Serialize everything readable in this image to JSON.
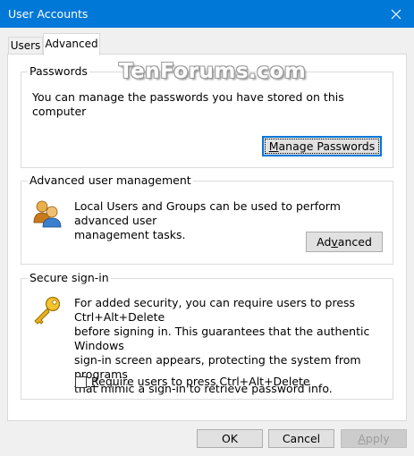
{
  "window": {
    "title": "User Accounts",
    "close_label": "✕"
  },
  "tabs": [
    {
      "label": "Users"
    },
    {
      "label": "Advanced"
    }
  ],
  "watermark": "TenForums.com",
  "passwords": {
    "title": "Passwords",
    "description": "You can manage the passwords you have stored on this computer",
    "button_mnemonic": "M",
    "button_rest": "anage Passwords"
  },
  "advanced_user_management": {
    "title": "Advanced user management",
    "description_line1": "Local Users and Groups can be used to perform advanced user",
    "description_line2": "management tasks.",
    "button_prefix": "Ad",
    "button_mnemonic": "v",
    "button_rest": "anced",
    "icon": "users-group-icon"
  },
  "secure_signin": {
    "title": "Secure sign-in",
    "description_lines": [
      "For added security, you can require users to press Ctrl+Alt+Delete",
      "before signing in. This guarantees that the authentic Windows",
      "sign-in screen appears, protecting the system from programs",
      "that mimic a sign-in to retrieve password info."
    ],
    "checkbox_mnemonic": "R",
    "checkbox_rest": "equire users to press Ctrl+Alt+Delete",
    "checked": false,
    "icon": "key-icon"
  },
  "footer": {
    "ok_label": "OK",
    "cancel_label": "Cancel",
    "apply_mnemonic": "A",
    "apply_rest": "pply"
  },
  "colors": {
    "titlebar": "#0078d7",
    "accent": "#0078d7"
  }
}
